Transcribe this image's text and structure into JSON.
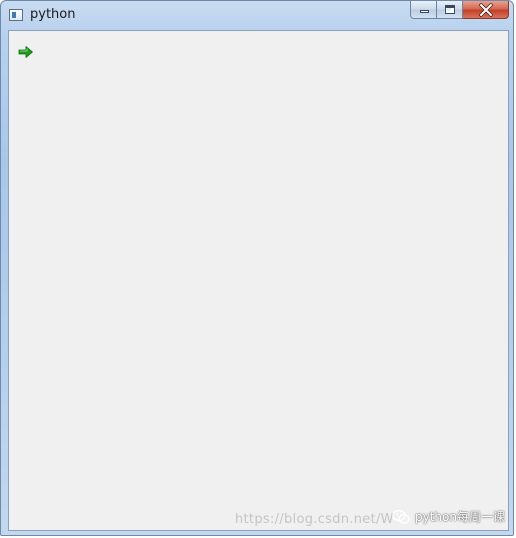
{
  "window": {
    "title": "python",
    "icon": "app-window-icon"
  },
  "caption_buttons": {
    "minimize": "minimize-icon",
    "maximize": "maximize-icon",
    "close": "close-icon"
  },
  "content": {
    "arrow_icon": "green-arrow-right-icon",
    "arrow_color": "#1c9b1c"
  },
  "watermark": {
    "url": "https://blog.csdn.net/W",
    "brand": "python每周一课",
    "brand_icon": "wechat-icon"
  },
  "colors": {
    "titlebar": "#b8d1ee",
    "client_background": "#f0f0f0",
    "close_button": "#c4402a"
  }
}
